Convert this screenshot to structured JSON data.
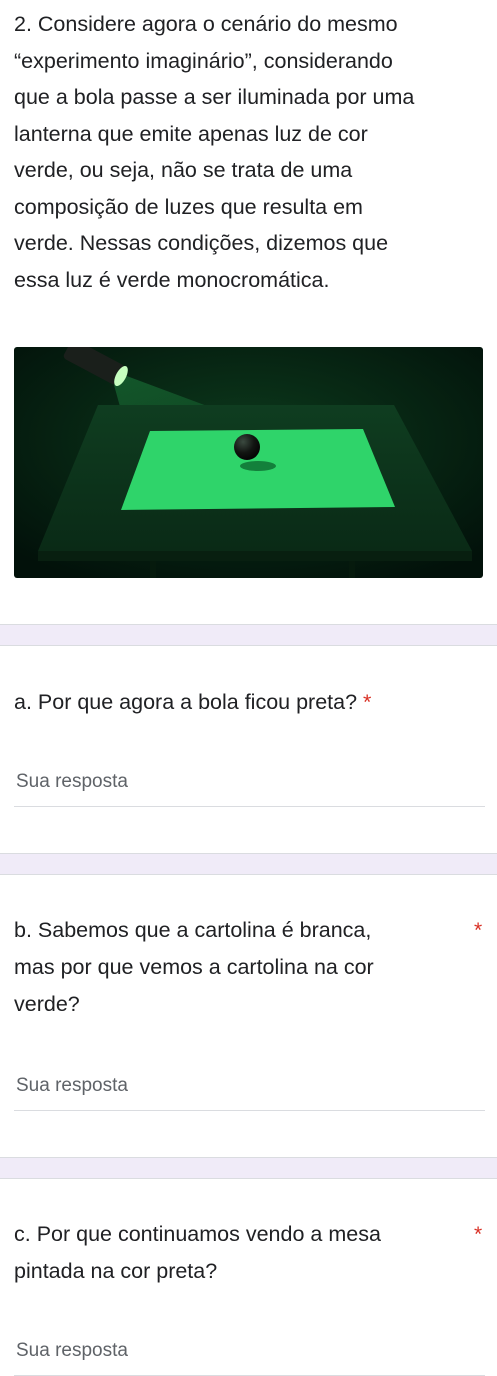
{
  "intro": {
    "line1": "2. Considere agora o cenário do mesmo",
    "line2": "“experimento imaginário”, considerando",
    "line3": "que a bola passe a ser iluminada por uma",
    "line4": "lanterna que emite apenas luz de cor",
    "line5": "verde, ou seja, não se trata de uma",
    "line6": "composição de luzes que resulta em",
    "line7": "verde. Nessas condições, dizemos que",
    "line8": "essa luz é verde monocromática."
  },
  "colors": {
    "background_scene": "#04160b",
    "table_top": "#0f3a1e",
    "card": "#2fd46a",
    "ball": "#111111",
    "required": "#d93025",
    "divider_band": "#f0ebf8"
  },
  "questions": [
    {
      "lines": [
        "a. Por que agora a bola ficou preta?"
      ],
      "required_mark": "*",
      "placeholder": "Sua resposta"
    },
    {
      "lines": [
        "b. Sabemos que a cartolina é branca,",
        "mas por que vemos a cartolina na cor",
        "verde?"
      ],
      "required_mark": "*",
      "placeholder": "Sua resposta"
    },
    {
      "lines": [
        "c. Por que continuamos vendo a mesa",
        "pintada na cor preta?"
      ],
      "required_mark": "*",
      "placeholder": "Sua resposta"
    }
  ]
}
